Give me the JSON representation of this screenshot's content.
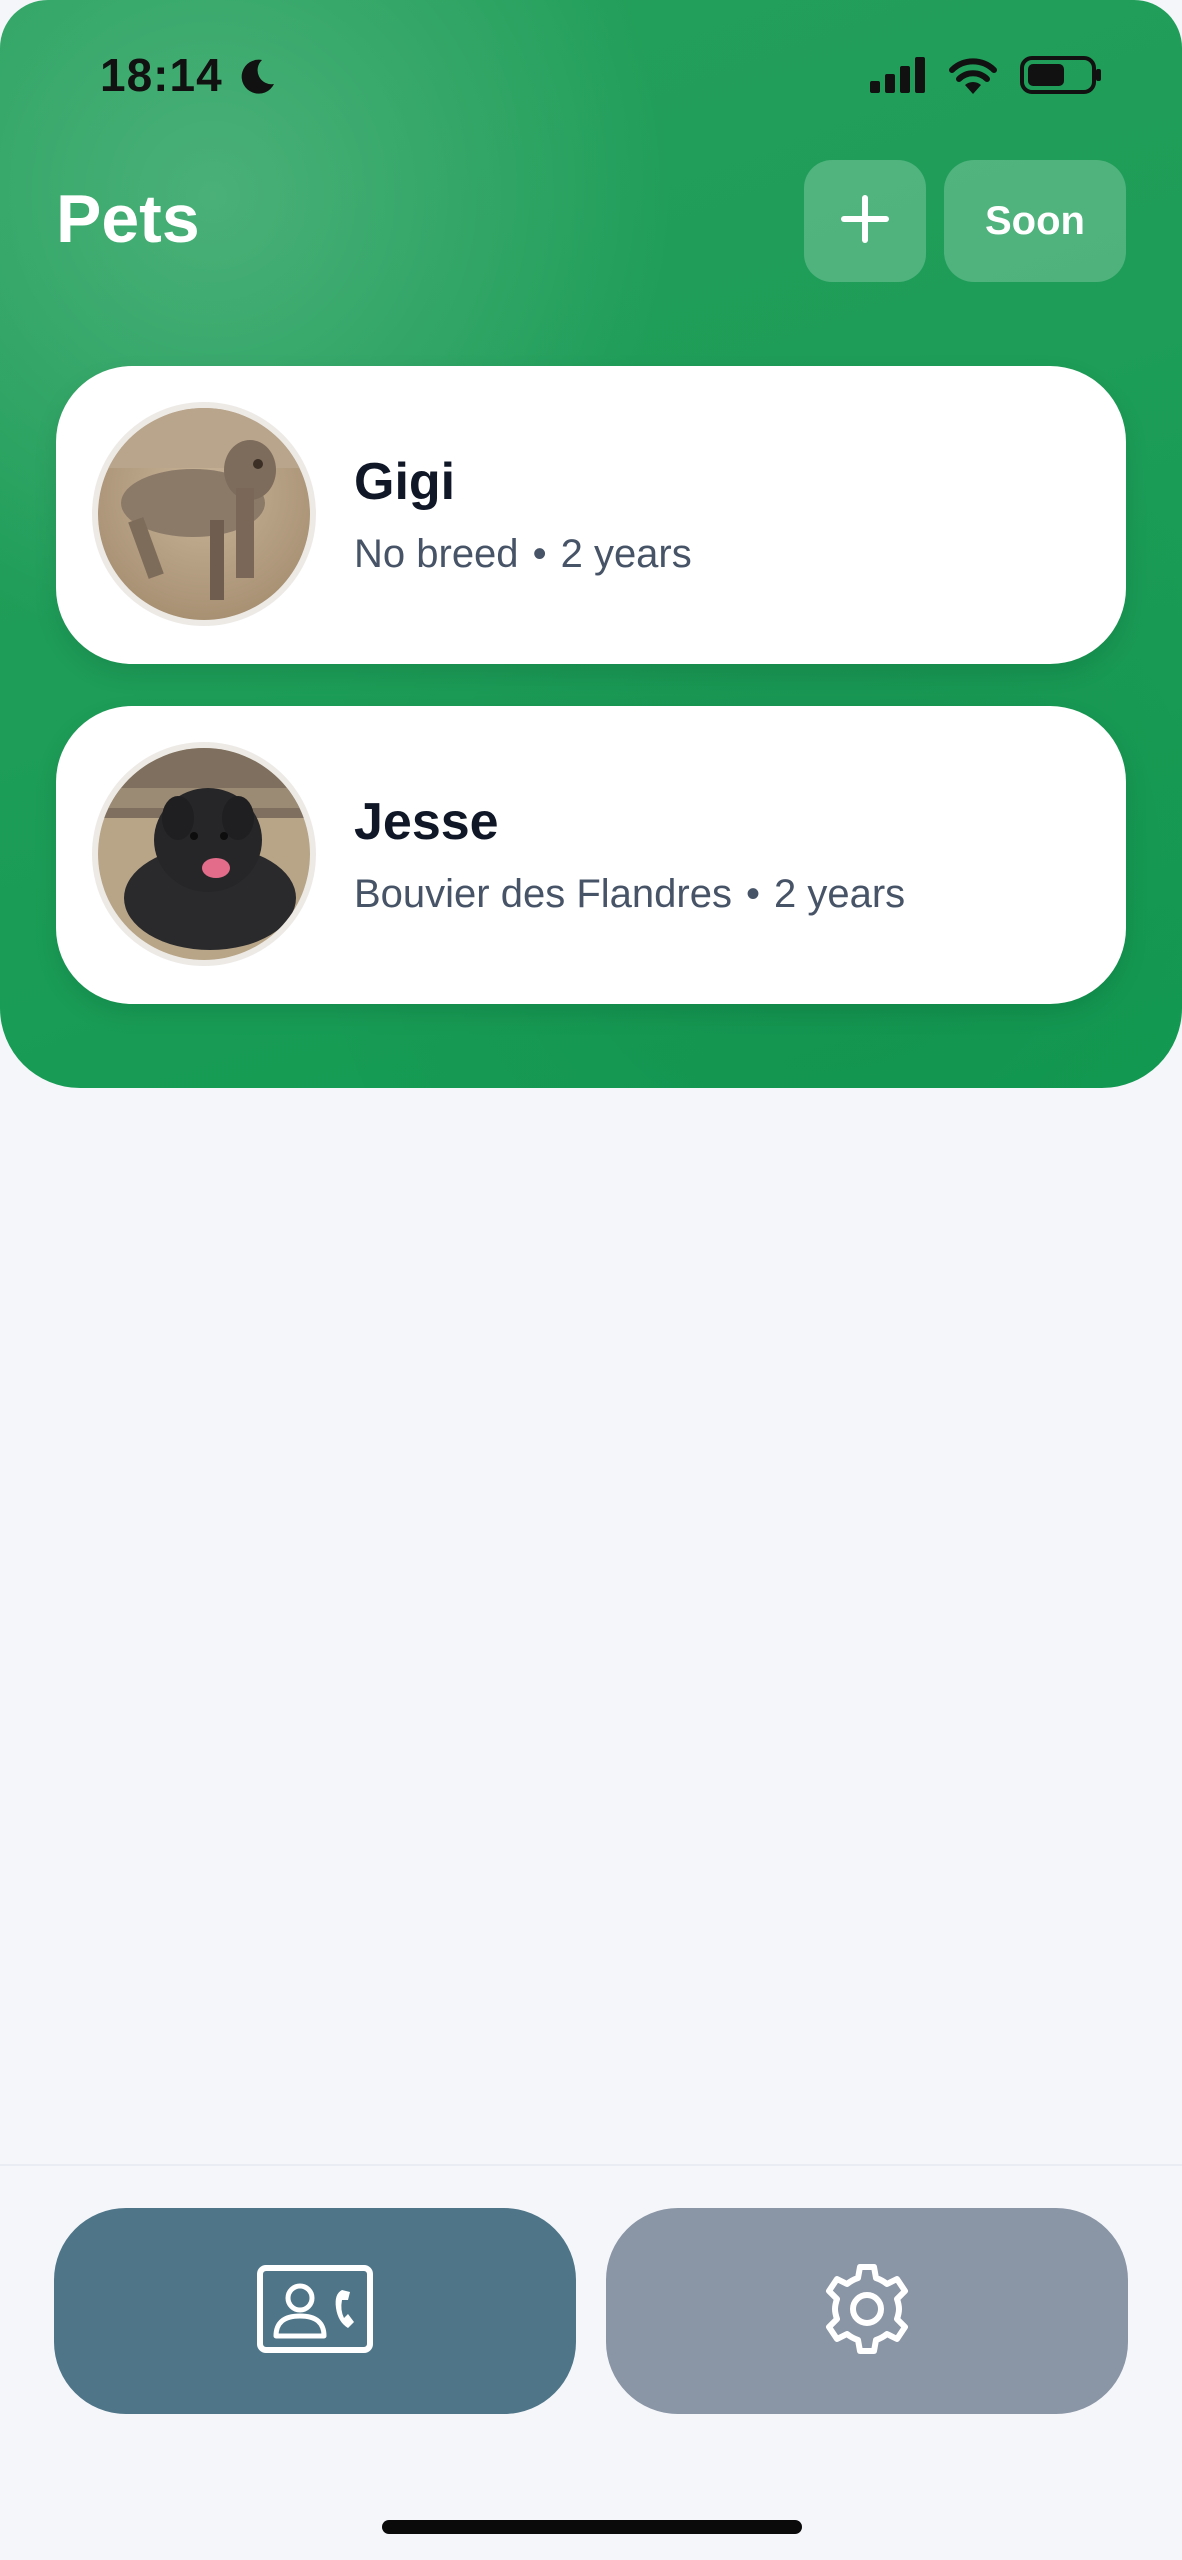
{
  "status_bar": {
    "time": "18:14",
    "icons": [
      "moon-icon",
      "cellular-signal-icon",
      "wifi-icon",
      "battery-icon"
    ]
  },
  "header": {
    "title": "Pets",
    "add_button_icon": "plus-icon",
    "soon_label": "Soon"
  },
  "pets": [
    {
      "name": "Gigi",
      "breed": "No breed",
      "separator": "•",
      "age": "2 years"
    },
    {
      "name": "Jesse",
      "breed": "Bouvier des Flandres",
      "separator": "•",
      "age": "2 years"
    }
  ],
  "bottom_nav": {
    "items": [
      {
        "icon": "contact-card-icon",
        "active": true
      },
      {
        "icon": "gear-icon",
        "active": false
      }
    ]
  },
  "colors": {
    "header_green": "#1E9D58",
    "contacts_button": "#4F7588",
    "settings_button": "#8A95A5",
    "background": "#F4F6FA"
  }
}
